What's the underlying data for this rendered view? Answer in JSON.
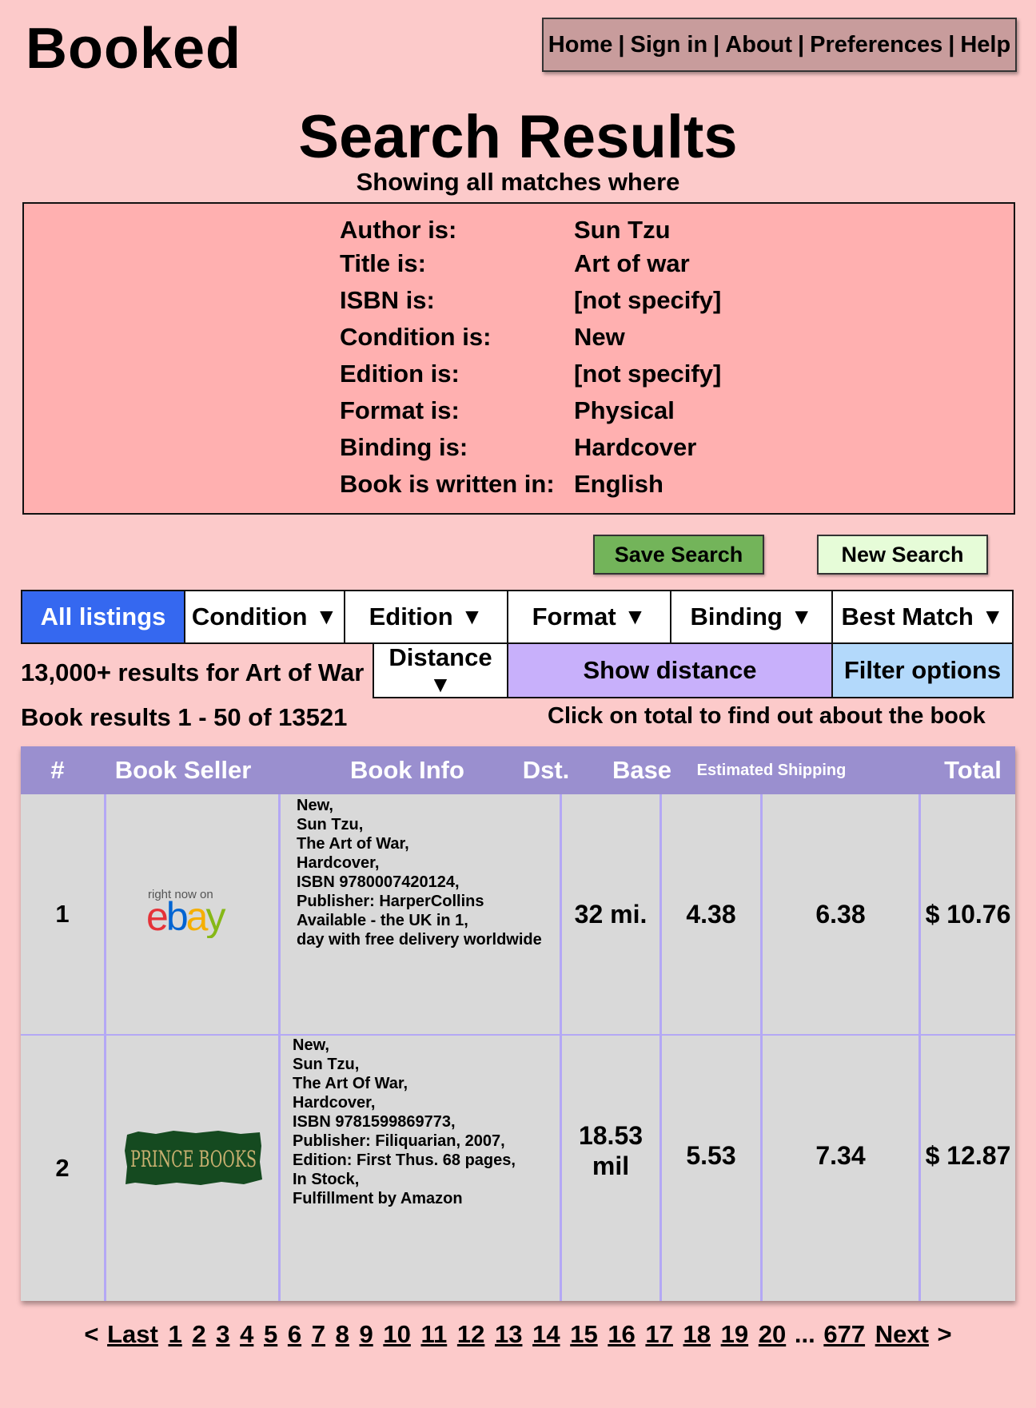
{
  "brand": "Booked",
  "nav": {
    "home": "Home",
    "sign_in": "Sign in",
    "about": "About",
    "preferences": "Preferences",
    "help": "Help",
    "separator": "|"
  },
  "title": "Search Results",
  "subtitle": "Showing all matches where",
  "criteria": [
    {
      "label": "Author is:",
      "value": "Sun Tzu"
    },
    {
      "label": "Title is:",
      "value": "Art of war"
    },
    {
      "label": "ISBN is:",
      "value": "[not specify]"
    },
    {
      "label": "Condition is:",
      "value": "New"
    },
    {
      "label": "Edition is:",
      "value": "[not specify]"
    },
    {
      "label": "Format is:",
      "value": "Physical"
    },
    {
      "label": "Binding is:",
      "value": "Hardcover"
    },
    {
      "label": "Book is written in:",
      "value": "English"
    }
  ],
  "buttons": {
    "save_search": "Save Search",
    "new_search": "New Search"
  },
  "tabs": {
    "all_listings": "All listings",
    "condition": "Condition",
    "edition": "Edition",
    "format": "Format",
    "binding": "Binding",
    "best_match": "Best Match",
    "distance": "Distance",
    "show_distance": "Show distance",
    "filter_options": "Filter options",
    "arrow": "▼"
  },
  "results_summary": "13,000+ results for Art of War",
  "results_range": "Book results 1 - 50 of 13521",
  "click_hint": "Click on total to find out about the book",
  "table": {
    "headers": {
      "num": "#",
      "seller": "Book Seller",
      "info": "Book Info",
      "dst": "Dst.",
      "base": "Base",
      "shipping": "Estimated Shipping",
      "total": "Total"
    },
    "rows": [
      {
        "num": "1",
        "seller_logo": {
          "small": "right now on",
          "big": "ebay"
        },
        "info": [
          "New,",
          "Sun Tzu,",
          "The Art of War,",
          "Hardcover,",
          "ISBN 9780007420124,",
          "Publisher: HarperCollins",
          "Available - the UK in 1,",
          "day with free delivery worldwide"
        ],
        "dst": "32 mi.",
        "base": "4.38",
        "shipping": "6.38",
        "total": "$ 10.76"
      },
      {
        "num": "2",
        "seller_logo": {
          "big": "PRINCE BOOKS"
        },
        "info": [
          "New,",
          "Sun Tzu,",
          "The Art Of War,",
          "Hardcover,",
          "ISBN 9781599869773,",
          "Publisher: Filiquarian, 2007,",
          "Edition: First Thus. 68 pages,",
          "In Stock,",
          "Fulfillment by Amazon"
        ],
        "dst_line1": "18.53",
        "dst_line2": "mil",
        "base": "5.53",
        "shipping": "7.34",
        "total": "$ 12.87"
      }
    ]
  },
  "pagination": {
    "prev_symbol": "<",
    "last": "Last",
    "pages": [
      "1",
      "2",
      "3",
      "4",
      "5",
      "6",
      "7",
      "8",
      "9",
      "10",
      "11",
      "12",
      "13",
      "14",
      "15",
      "16",
      "17",
      "18",
      "19",
      "20"
    ],
    "ellipsis": "...",
    "final_page": "677",
    "next": "Next",
    "next_symbol": ">"
  },
  "colors": {
    "background": "#fccaca",
    "criteria_bg": "#ffb0b0",
    "nav_bg": "#c89c9c",
    "save_btn": "#73b45a",
    "new_btn": "#e6fcd8",
    "tab_active": "#3568f0",
    "show_distance": "#c8b0fb",
    "filter_options": "#b3d9fb",
    "table_header": "#9a8fcf",
    "table_body": "#d9d9d9"
  }
}
